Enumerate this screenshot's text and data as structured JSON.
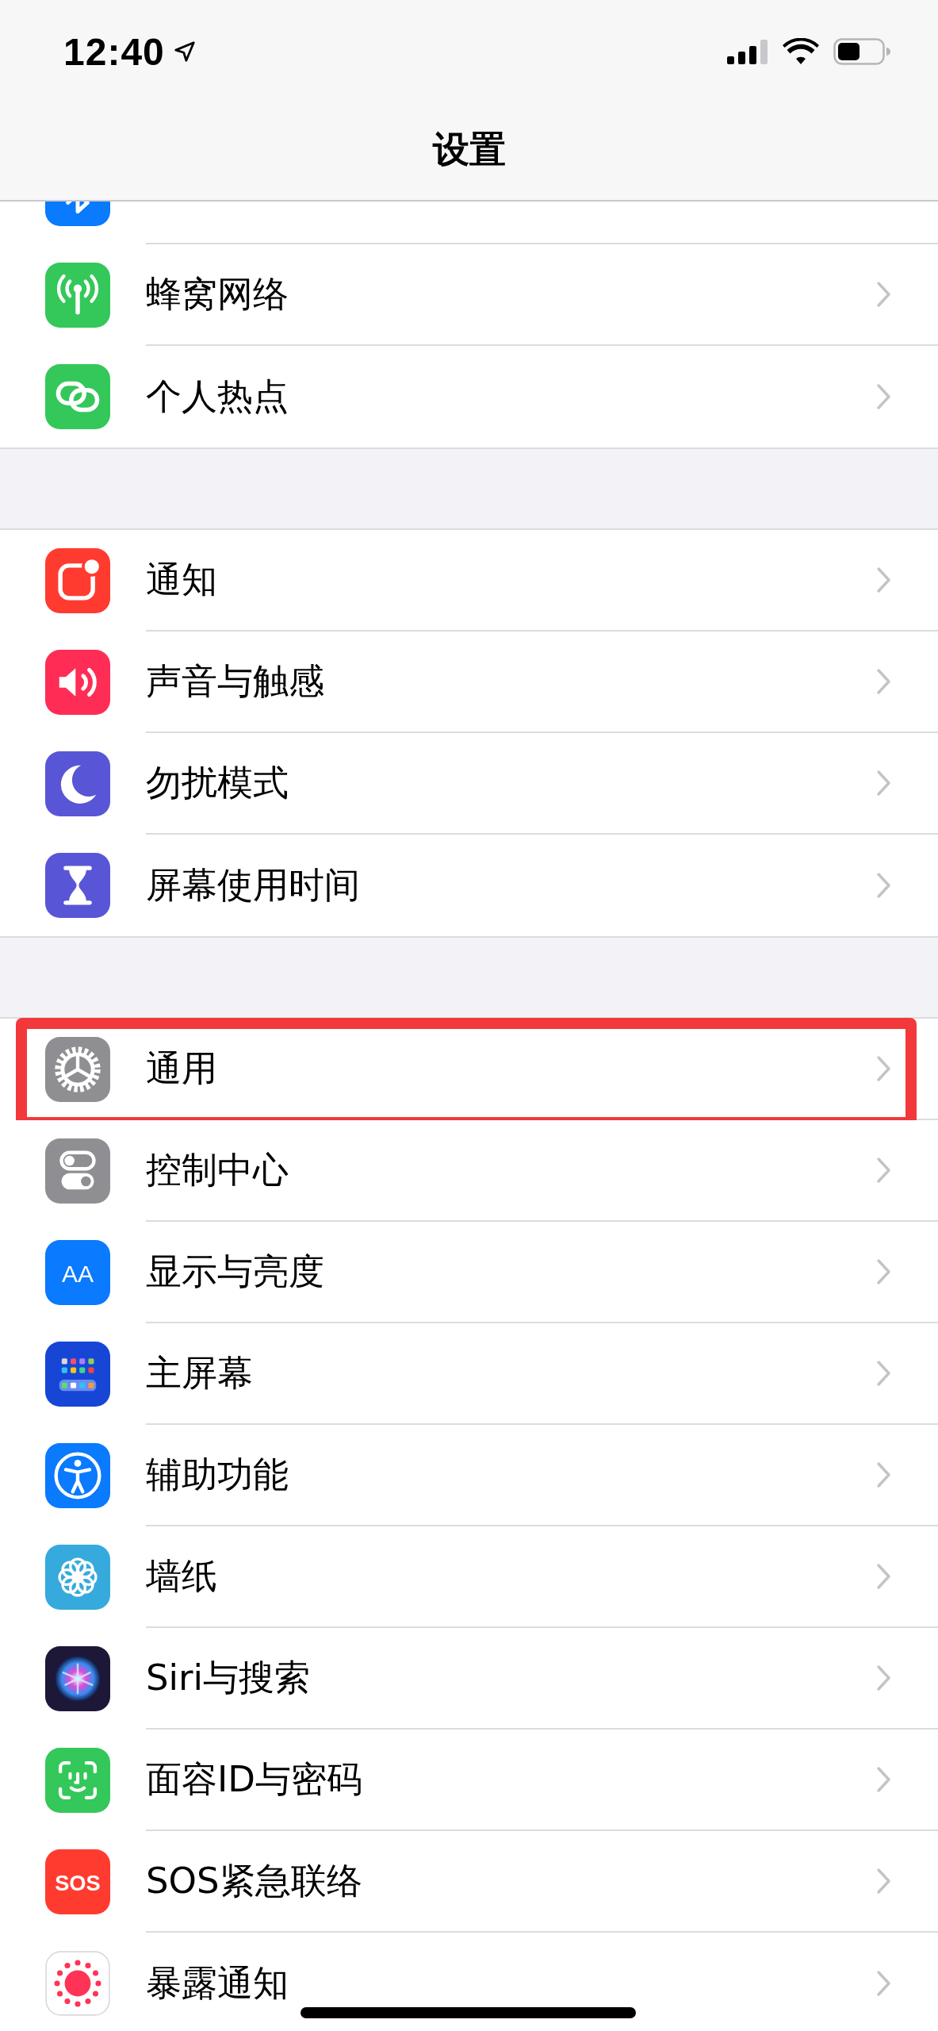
{
  "status_bar": {
    "time": "12:40"
  },
  "nav_bar": {
    "title": "设置"
  },
  "clipped_row": {
    "kind": "bluetooth"
  },
  "groups": [
    {
      "rows": [
        {
          "label": "蜂窝网络",
          "kind": "cellular",
          "highlighted": false
        },
        {
          "label": "个人热点",
          "kind": "hotspot",
          "highlighted": false
        }
      ]
    },
    {
      "rows": [
        {
          "label": "通知",
          "kind": "notifications",
          "highlighted": false
        },
        {
          "label": "声音与触感",
          "kind": "sounds",
          "highlighted": false
        },
        {
          "label": "勿扰模式",
          "kind": "dnd",
          "highlighted": false
        },
        {
          "label": "屏幕使用时间",
          "kind": "screentime",
          "highlighted": false
        }
      ]
    },
    {
      "rows": [
        {
          "label": "通用",
          "kind": "general",
          "highlighted": true
        },
        {
          "label": "控制中心",
          "kind": "controlcenter",
          "highlighted": false
        },
        {
          "label": "显示与亮度",
          "kind": "display",
          "icon_text": "AA",
          "highlighted": false
        },
        {
          "label": "主屏幕",
          "kind": "homescreen",
          "highlighted": false
        },
        {
          "label": "辅助功能",
          "kind": "accessibility",
          "highlighted": false
        },
        {
          "label": "墙纸",
          "kind": "wallpaper",
          "highlighted": false
        },
        {
          "label": "Siri与搜索",
          "kind": "siri",
          "highlighted": false
        },
        {
          "label": "面容ID与密码",
          "kind": "faceid",
          "highlighted": false
        },
        {
          "label": "SOS紧急联络",
          "kind": "sos",
          "icon_text": "SOS",
          "highlighted": false
        },
        {
          "label": "暴露通知",
          "kind": "exposure",
          "highlighted": false
        }
      ]
    }
  ]
}
